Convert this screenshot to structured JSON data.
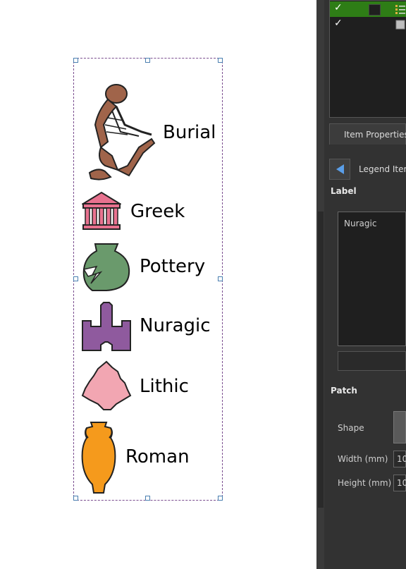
{
  "legend": {
    "items": [
      {
        "label": "Burial",
        "icon": "skeleton-icon",
        "color": "#a0644a"
      },
      {
        "label": "Greek",
        "icon": "temple-icon",
        "color": "#e8728f"
      },
      {
        "label": "Pottery",
        "icon": "broken-pot-icon",
        "color": "#6a9a6c"
      },
      {
        "label": "Nuragic",
        "icon": "tower-icon",
        "color": "#8f5a9e"
      },
      {
        "label": "Lithic",
        "icon": "arrowhead-icon",
        "color": "#f2a6b2"
      },
      {
        "label": "Roman",
        "icon": "amphora-icon",
        "color": "#f59a1c"
      }
    ]
  },
  "panel": {
    "layers": [
      {
        "checked": "✓",
        "selected": true
      },
      {
        "checked": "✓",
        "selected": false
      }
    ],
    "tab_label": "Item Properties",
    "legend_item_title": "Legend Item",
    "label_section": "Label",
    "label_value": "Nuragic",
    "patch_section": "Patch",
    "shape_label": "Shape",
    "width_label": "Width (mm)",
    "width_value": "10",
    "height_label": "Height (mm)",
    "height_value": "10"
  },
  "colors": {
    "selection_green": "#2e7d16",
    "frame": "#7a4d8f",
    "accent_blue": "#5a9ee8"
  }
}
